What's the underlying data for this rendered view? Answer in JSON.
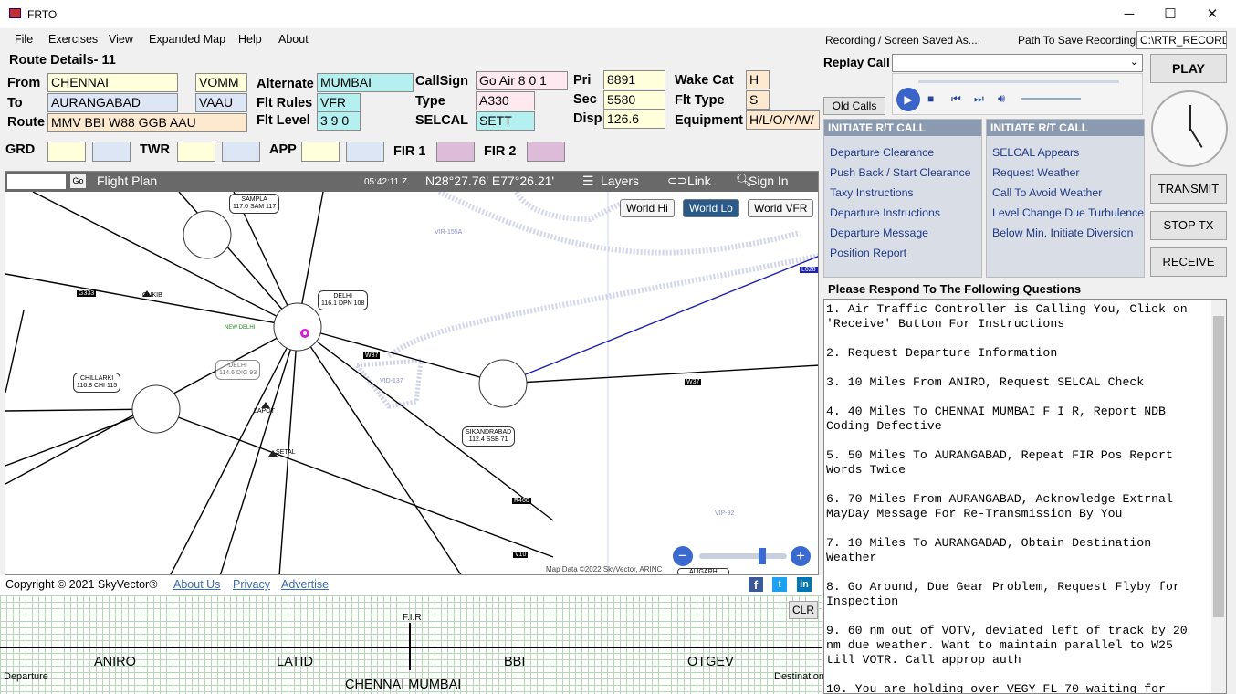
{
  "window": {
    "title": "FRTO",
    "min": "─",
    "max": "☐",
    "close": "✕"
  },
  "menu": [
    "File",
    "Exercises",
    "View",
    "Expanded Map",
    "Help",
    "About"
  ],
  "route": {
    "heading": "Route Details- 11",
    "from_label": "From",
    "from": "CHENNAI",
    "from_code": "VOMM",
    "to_label": "To",
    "to": "AURANGABAD",
    "to_code": "VAAU",
    "route_label": "Route",
    "route": "MMV BBI W88 GGB AAU",
    "alternate_label": "Alternate",
    "alternate": "MUMBAI",
    "flt_rules_label": "Flt Rules",
    "flt_rules": "VFR",
    "flt_level_label": "Flt Level",
    "flt_level": "3 9 0",
    "callsign_label": "CallSign",
    "callsign": "Go Air 8 0 1",
    "type_label": "Type",
    "type": "A330",
    "selcal_label": "SELCAL",
    "selcal": "SETT",
    "pri_label": "Pri",
    "pri": "8891",
    "sec_label": "Sec",
    "sec": "5580",
    "disp_label": "Disp",
    "disp": "126.6",
    "wake_label": "Wake Cat",
    "wake": "H",
    "flt_type_label": "Flt Type",
    "flt_type": "S",
    "equip_label": "Equipment",
    "equip": "H/L/O/Y/W/",
    "grd": "GRD",
    "twr": "TWR",
    "app": "APP",
    "fir1": "FIR 1",
    "fir2": "FIR 2"
  },
  "map": {
    "flight_plan": "Flight Plan",
    "go": "Go",
    "time": "05:42:11 Z",
    "coords": "N28°27.76' E77°26.21'",
    "layers": "Layers",
    "link": "Link",
    "signin": "Sign In",
    "world_hi": "World Hi",
    "world_lo": "World Lo",
    "world_vfr": "World VFR",
    "data_credit": "Map Data ©2022 SkyVector, ARINC",
    "labels": {
      "sampla": "SAMPLA",
      "sampla_f": "117.0 SAM 117",
      "delhi": "DELHI",
      "delhi_f": "116.1 DPN 108",
      "chillarki": "CHILLARKI",
      "chillarki_f": "116.8 CHI 115",
      "sikandrabad": "SIKANDRABAD",
      "sikandrabad_f": "112.4 SSB 71",
      "delhi2": "DELHI",
      "delhi2_f": "114.6 DIG 93",
      "gukib": "GUKIB",
      "lapot": "LAPOT",
      "setal": "SETAL",
      "aligarh": "ALIGARH",
      "vir155": "VIR-155A",
      "vid137": "VID-137",
      "vip92": "VIP-92",
      "newdelhi": "NEW DELHI",
      "w37": "W37",
      "w37b": "W37",
      "l626": "L626",
      "g333": "G333",
      "v10": "V10",
      "r460": "R460"
    }
  },
  "footer": {
    "copyright": "Copyright © 2021 SkyVector®",
    "about": "About Us",
    "privacy": "Privacy",
    "advertise": "Advertise"
  },
  "strip": {
    "clr": "CLR",
    "fir": "F.I.R",
    "departure": "Departure",
    "destination": "Destination",
    "aniro": "ANIRO",
    "latid": "LATID",
    "bbi": "BBI",
    "otgev": "OTGEV",
    "chennai_mumbai": "CHENNAI MUMBAI"
  },
  "right": {
    "recording": "Recording / Screen Saved As....",
    "path_label": "Path To Save Recordings",
    "path": "C:\\RTR_RECORDI",
    "replay": "Replay Call",
    "old_calls": "Old Calls",
    "play": "PLAY",
    "transmit": "TRANSMIT",
    "stop": "STOP TX",
    "receive": "RECEIVE",
    "box1_title": "INITIATE R/T CALL",
    "box1": [
      "Departure Clearance",
      "Push Back / Start Clearance",
      "Taxy Instructions",
      "Departure Instructions",
      "Departure Message",
      "Position Report"
    ],
    "box2_title": "INITIATE R/T CALL",
    "box2": [
      "SELCAL Appears",
      "Request Weather",
      "Call To Avoid Weather",
      "Level Change Due Turbulence",
      "Below Min. Initiate Diversion"
    ],
    "questions_title": "Please Respond To The Following Questions",
    "questions": [
      "1. Air Traffic Controller is Calling You, Click on 'Receive' Button For Instructions",
      "2. Request Departure Information",
      "3. 10 Miles From ANIRO, Request SELCAL Check",
      "4. 40 Miles To CHENNAI MUMBAI F I R, Report NDB Coding Defective",
      "5. 50 Miles To AURANGABAD, Repeat FIR Pos Report Words Twice",
      "6. 70 Miles From AURANGABAD, Acknowledge Extrnal MayDay Message For Re-Transmission By You",
      "7. 10 Miles To AURANGABAD, Obtain Destination Weather",
      "8. Go Around, Due Gear Problem, Request Flyby for Inspection",
      "9. 60 nm out of VOTV, deviated left of track by 20 nm due weather. Want to maintain parallel to W25 till VOTR. Call approp auth",
      "10. You are holding over VEGY FL 70 waiting for"
    ]
  }
}
